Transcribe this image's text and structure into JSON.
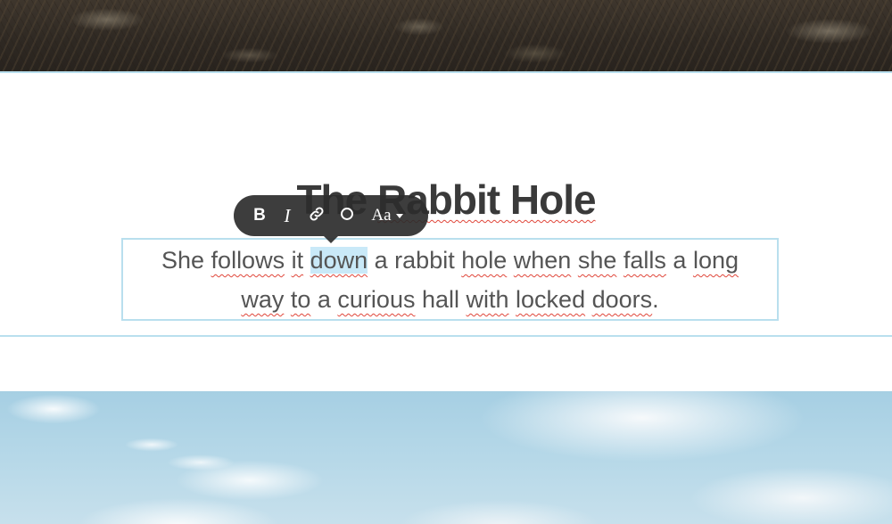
{
  "photos": {
    "top_alt": "rocky ground photo",
    "bottom_alt": "sky with clouds photo"
  },
  "section": {
    "title_part1": "The ",
    "title_part2": "Rabbit Hole",
    "body": {
      "line1_before": "She ",
      "line1_w1": "follows",
      "line1_sp1": " ",
      "line1_w2": "it",
      "line1_sp2": " ",
      "selected_word": "down",
      "line1_after": " a rabbit ",
      "line1_w3": "hole",
      "line1_sp3": " ",
      "line1_w4": "when",
      "line1_sp4": " ",
      "line1_w5": "she",
      "line1_sp5": " ",
      "line1_w6": "falls",
      "line1_sp6": " a ",
      "line1_w7": "long",
      "line2_w1": "way",
      "line2_sp1": " ",
      "line2_w2": "to",
      "line2_sp2": " a ",
      "line2_w3": "curious",
      "line2_sp3": " hall ",
      "line2_w4": "with",
      "line2_sp4": " ",
      "line2_w5": "locked",
      "line2_sp5": " ",
      "line2_w6": "doors",
      "line2_end": "."
    }
  },
  "toolbar": {
    "bold_label": "B",
    "italic_label": "I",
    "link_icon": "link-icon",
    "color_icon": "circle-icon",
    "size_label": "Aa"
  },
  "colors": {
    "accent_border": "#b9dfee",
    "selection": "#c9e9f8",
    "toolbar_bg": "#2c2c2c",
    "spellcheck": "#e0463a"
  }
}
